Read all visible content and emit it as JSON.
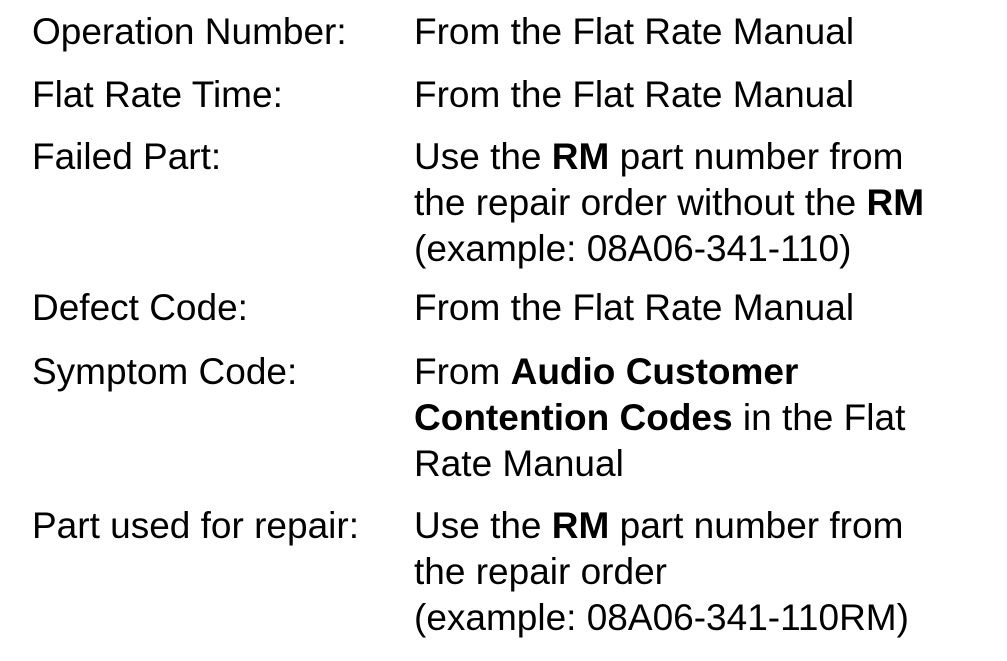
{
  "rows": [
    {
      "label": "Operation Number:",
      "lines": [
        [
          "From the Flat Rate Manual",
          "",
          ""
        ]
      ]
    },
    {
      "label": "Flat Rate Time:",
      "lines": [
        [
          "From the Flat Rate Manual",
          "",
          ""
        ]
      ]
    },
    {
      "label": "Failed Part:",
      "lines": [
        [
          "Use the ",
          "RM",
          " part number from"
        ],
        [
          "the repair order without the ",
          "RM",
          ""
        ],
        [
          "(example: 08A06-341-110)",
          "",
          ""
        ]
      ]
    },
    {
      "label": "Defect Code:",
      "lines": [
        [
          "From the Flat Rate Manual",
          "",
          ""
        ]
      ]
    },
    {
      "label": "Symptom Code:",
      "lines": [
        [
          "From ",
          "Audio Customer",
          ""
        ],
        [
          "",
          "Contention Codes",
          " in the Flat"
        ],
        [
          "Rate Manual",
          "",
          ""
        ]
      ]
    },
    {
      "label": "Part used for repair:",
      "lines": [
        [
          "Use the ",
          "RM",
          " part number from"
        ],
        [
          "the repair order",
          "",
          ""
        ],
        [
          "(example: 08A06-341-110RM)",
          "",
          ""
        ]
      ]
    }
  ]
}
